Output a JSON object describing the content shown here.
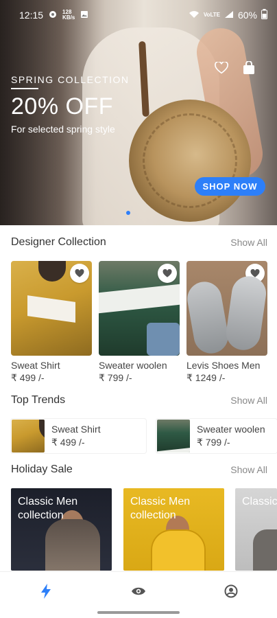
{
  "status_bar": {
    "time": "12:15",
    "data_label": "128\nKB/s",
    "network_label": "VoLTE",
    "battery": "60%"
  },
  "hero": {
    "eyebrow": "SPRING COLLECTION",
    "title": "20% OFF",
    "subtitle": "For selected spring style",
    "cta": "SHOP NOW",
    "icons": [
      "heart-outline-icon",
      "shopping-bag-icon"
    ]
  },
  "designer": {
    "title": "Designer Collection",
    "show_all": "Show All",
    "items": [
      {
        "name": "Sweat Shirt",
        "price": "₹ 499 /-"
      },
      {
        "name": "Sweater woolen",
        "price": "₹ 799 /-"
      },
      {
        "name": "Levis Shoes Men",
        "price": "₹ 1249 /-"
      }
    ]
  },
  "trends": {
    "title": "Top Trends",
    "show_all": "Show All",
    "items": [
      {
        "name": "Sweat Shirt",
        "price": "₹ 499 /-"
      },
      {
        "name": "Sweater woolen",
        "price": "₹ 799 /-"
      }
    ]
  },
  "holiday": {
    "title": "Holiday Sale",
    "show_all": "Show All",
    "banners": [
      {
        "label": "Classic Men collection"
      },
      {
        "label": "Classic Men collection"
      },
      {
        "label": "Classic Men collection"
      }
    ]
  },
  "nav": {
    "items": [
      "lightning-icon",
      "eye-icon",
      "profile-icon"
    ],
    "accent": "#2d7ff9"
  },
  "colors": {
    "accent": "#2d7ff9"
  }
}
